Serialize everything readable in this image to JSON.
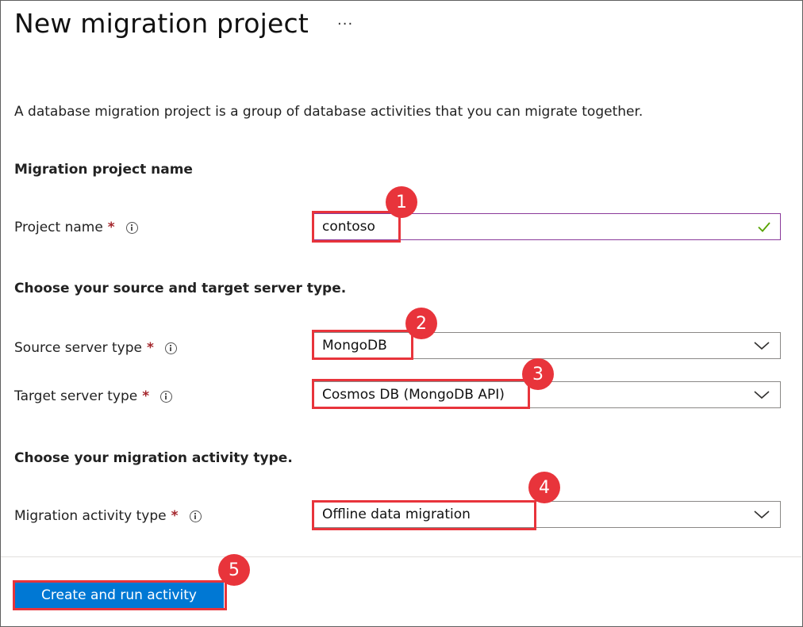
{
  "header": {
    "title": "New migration project",
    "more_label": "···"
  },
  "description": "A database migration project is a group of database activities that you can migrate together.",
  "sections": {
    "project_name": "Migration project name",
    "server_types": "Choose your source and target server type.",
    "activity_type": "Choose your migration activity type."
  },
  "fields": {
    "project_name": {
      "label": "Project name",
      "required_mark": "*",
      "value": "contoso"
    },
    "source_server": {
      "label": "Source server type",
      "required_mark": "*",
      "value": "MongoDB"
    },
    "target_server": {
      "label": "Target server type",
      "required_mark": "*",
      "value": "Cosmos DB (MongoDB API)"
    },
    "activity_type": {
      "label": "Migration activity type",
      "required_mark": "*",
      "value": "Offline data migration"
    }
  },
  "callouts": [
    "1",
    "2",
    "3",
    "4",
    "5"
  ],
  "actions": {
    "create_label": "Create and run activity"
  },
  "colors": {
    "accent": "#0078d4",
    "callout": "#e8343b",
    "valid_check": "#57a300",
    "required": "#a4262c"
  }
}
